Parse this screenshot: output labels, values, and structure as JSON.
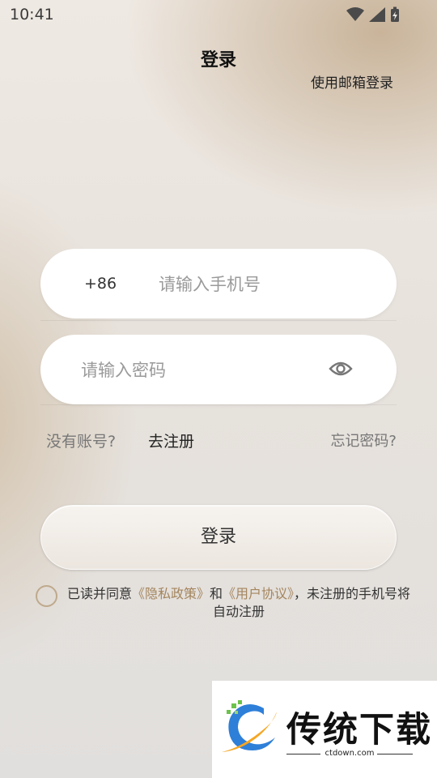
{
  "status_bar": {
    "time": "10:41"
  },
  "header": {
    "title": "登录",
    "email_login": "使用邮箱登录"
  },
  "phone": {
    "country_code": "+86",
    "placeholder": "请输入手机号",
    "value": ""
  },
  "password": {
    "placeholder": "请输入密码",
    "value": "",
    "toggle_icon": "eye-icon"
  },
  "links": {
    "no_account": "没有账号?",
    "register": "去注册",
    "forgot": "忘记密码?"
  },
  "login_button": {
    "label": "登录"
  },
  "agreement": {
    "prefix": "已读并同意",
    "privacy": "《隐私政策》",
    "and": "和",
    "terms": "《用户协议》",
    "suffix": "，未注册的手机号将自动注册",
    "checked": false
  },
  "watermark": {
    "name": "传统下载",
    "url": "ctdown.com"
  },
  "colors": {
    "accent": "#a4855d",
    "checkbox_border": "#bfa98c"
  }
}
